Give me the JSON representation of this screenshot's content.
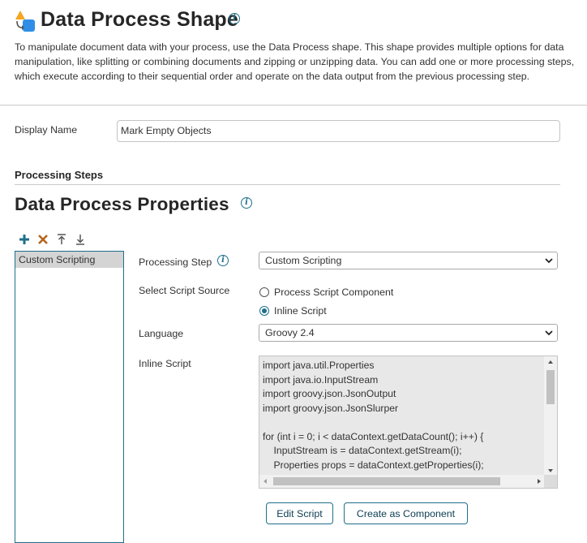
{
  "header": {
    "title": "Data Process Shape",
    "description": "To manipulate document data with your process, use the Data Process shape. This shape provides multiple options for data manipulation, like splitting or combining documents and zipping or unzipping data. You can add one or more processing steps, which execute according to their sequential order and operate on the data output from the previous processing step.",
    "icon": "data-process-shape-icon",
    "info_icon": "info-icon"
  },
  "display_name": {
    "label": "Display Name",
    "value": "Mark Empty Objects"
  },
  "processing_steps_section": {
    "title": "Processing Steps"
  },
  "properties": {
    "title": "Data Process Properties"
  },
  "toolbar": {
    "add_icon": "plus-icon",
    "delete_icon": "x-icon",
    "move_top_icon": "move-to-top-icon",
    "move_bottom_icon": "move-to-bottom-icon",
    "colors": {
      "add": "#1f6f8b",
      "delete": "#b5651d",
      "move": "#555555"
    }
  },
  "steps": [
    {
      "label": "Custom Scripting",
      "selected": true
    }
  ],
  "form": {
    "processing_step": {
      "label": "Processing Step",
      "value": "Custom Scripting"
    },
    "script_source": {
      "label": "Select Script Source",
      "options": [
        {
          "label": "Process Script Component",
          "checked": false
        },
        {
          "label": "Inline Script",
          "checked": true
        }
      ]
    },
    "language": {
      "label": "Language",
      "value": "Groovy 2.4"
    },
    "inline_script": {
      "label": "Inline Script",
      "lines": [
        "import java.util.Properties",
        "import java.io.InputStream",
        "import groovy.json.JsonOutput",
        "import groovy.json.JsonSlurper",
        "",
        "for (int i = 0; i < dataContext.getDataCount(); i++) {",
        "    InputStream is = dataContext.getStream(i);",
        "    Properties props = dataContext.getProperties(i);"
      ]
    }
  },
  "buttons": {
    "edit_script": "Edit Script",
    "create_component": "Create as Component"
  },
  "colors": {
    "accent": "#1f6f8b",
    "icon_orange": "#f5a623",
    "icon_blue": "#2f8fe6"
  }
}
